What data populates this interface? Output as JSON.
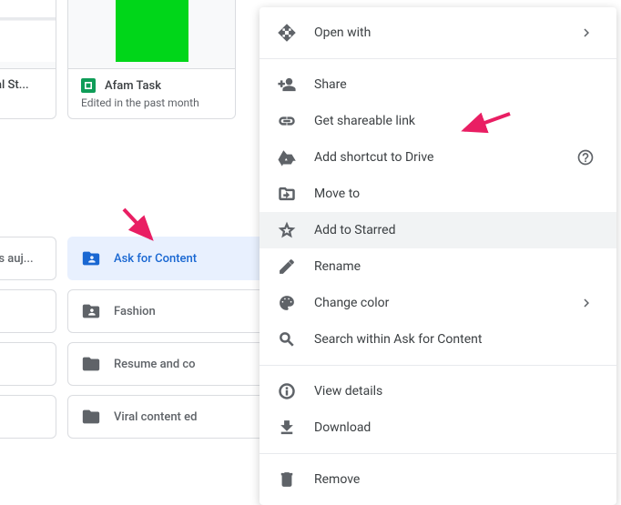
{
  "files": [
    {
      "name": "al St...",
      "subtitle": ""
    },
    {
      "name": "Afam Task",
      "subtitle": "Edited in the past month"
    }
  ],
  "folders": [
    {
      "sideLabel": "is auj...",
      "name": "Ask for Content",
      "shared": true,
      "selected": true
    },
    {
      "sideLabel": "",
      "name": "Fashion",
      "shared": true
    },
    {
      "sideLabel": "",
      "name": "Resume and co",
      "shared": false
    },
    {
      "sideLabel": "",
      "name": "Viral content ed",
      "shared": false
    }
  ],
  "menu": {
    "open_with": "Open with",
    "share": "Share",
    "get_link": "Get shareable link",
    "add_shortcut": "Add shortcut to Drive",
    "move_to": "Move to",
    "add_starred": "Add to Starred",
    "rename": "Rename",
    "change_color": "Change color",
    "search_within": "Search within Ask for Content",
    "view_details": "View details",
    "download": "Download",
    "remove": "Remove"
  }
}
